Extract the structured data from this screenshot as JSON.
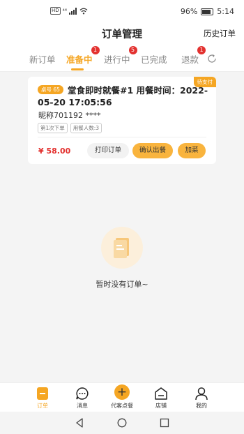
{
  "status_bar": {
    "network": "HD",
    "signal_tag": "⁴⁶",
    "battery": "96%",
    "time": "5:14"
  },
  "header": {
    "title": "订单管理",
    "history": "历史订单"
  },
  "tabs": [
    {
      "label": "新订单",
      "badge": ""
    },
    {
      "label": "准备中",
      "badge": "1"
    },
    {
      "label": "进行中",
      "badge": "5"
    },
    {
      "label": "已完成",
      "badge": ""
    },
    {
      "label": "退款",
      "badge": "1"
    }
  ],
  "order": {
    "status_tag": "待支付",
    "table_tag": "桌号 65",
    "title": "堂食即时就餐#1 用餐时间：2022-05-20 17:05:56",
    "customer": "昵称701192  ****",
    "chips": [
      "第1次下单",
      "用餐人数:3"
    ],
    "price": "¥ 58.00",
    "buttons": {
      "print": "打印订单",
      "confirm": "确认出餐",
      "add": "加菜"
    }
  },
  "empty_state": {
    "text": "暂时没有订单~"
  },
  "bottom_nav": [
    {
      "label": "订单",
      "icon": "order-icon"
    },
    {
      "label": "消息",
      "icon": "message-icon"
    },
    {
      "label": "代客点餐",
      "icon": "plus-icon"
    },
    {
      "label": "店铺",
      "icon": "store-icon"
    },
    {
      "label": "我的",
      "icon": "user-icon"
    }
  ],
  "colors": {
    "accent": "#f5a623",
    "badge": "#e3312f",
    "price": "#e3312f"
  }
}
